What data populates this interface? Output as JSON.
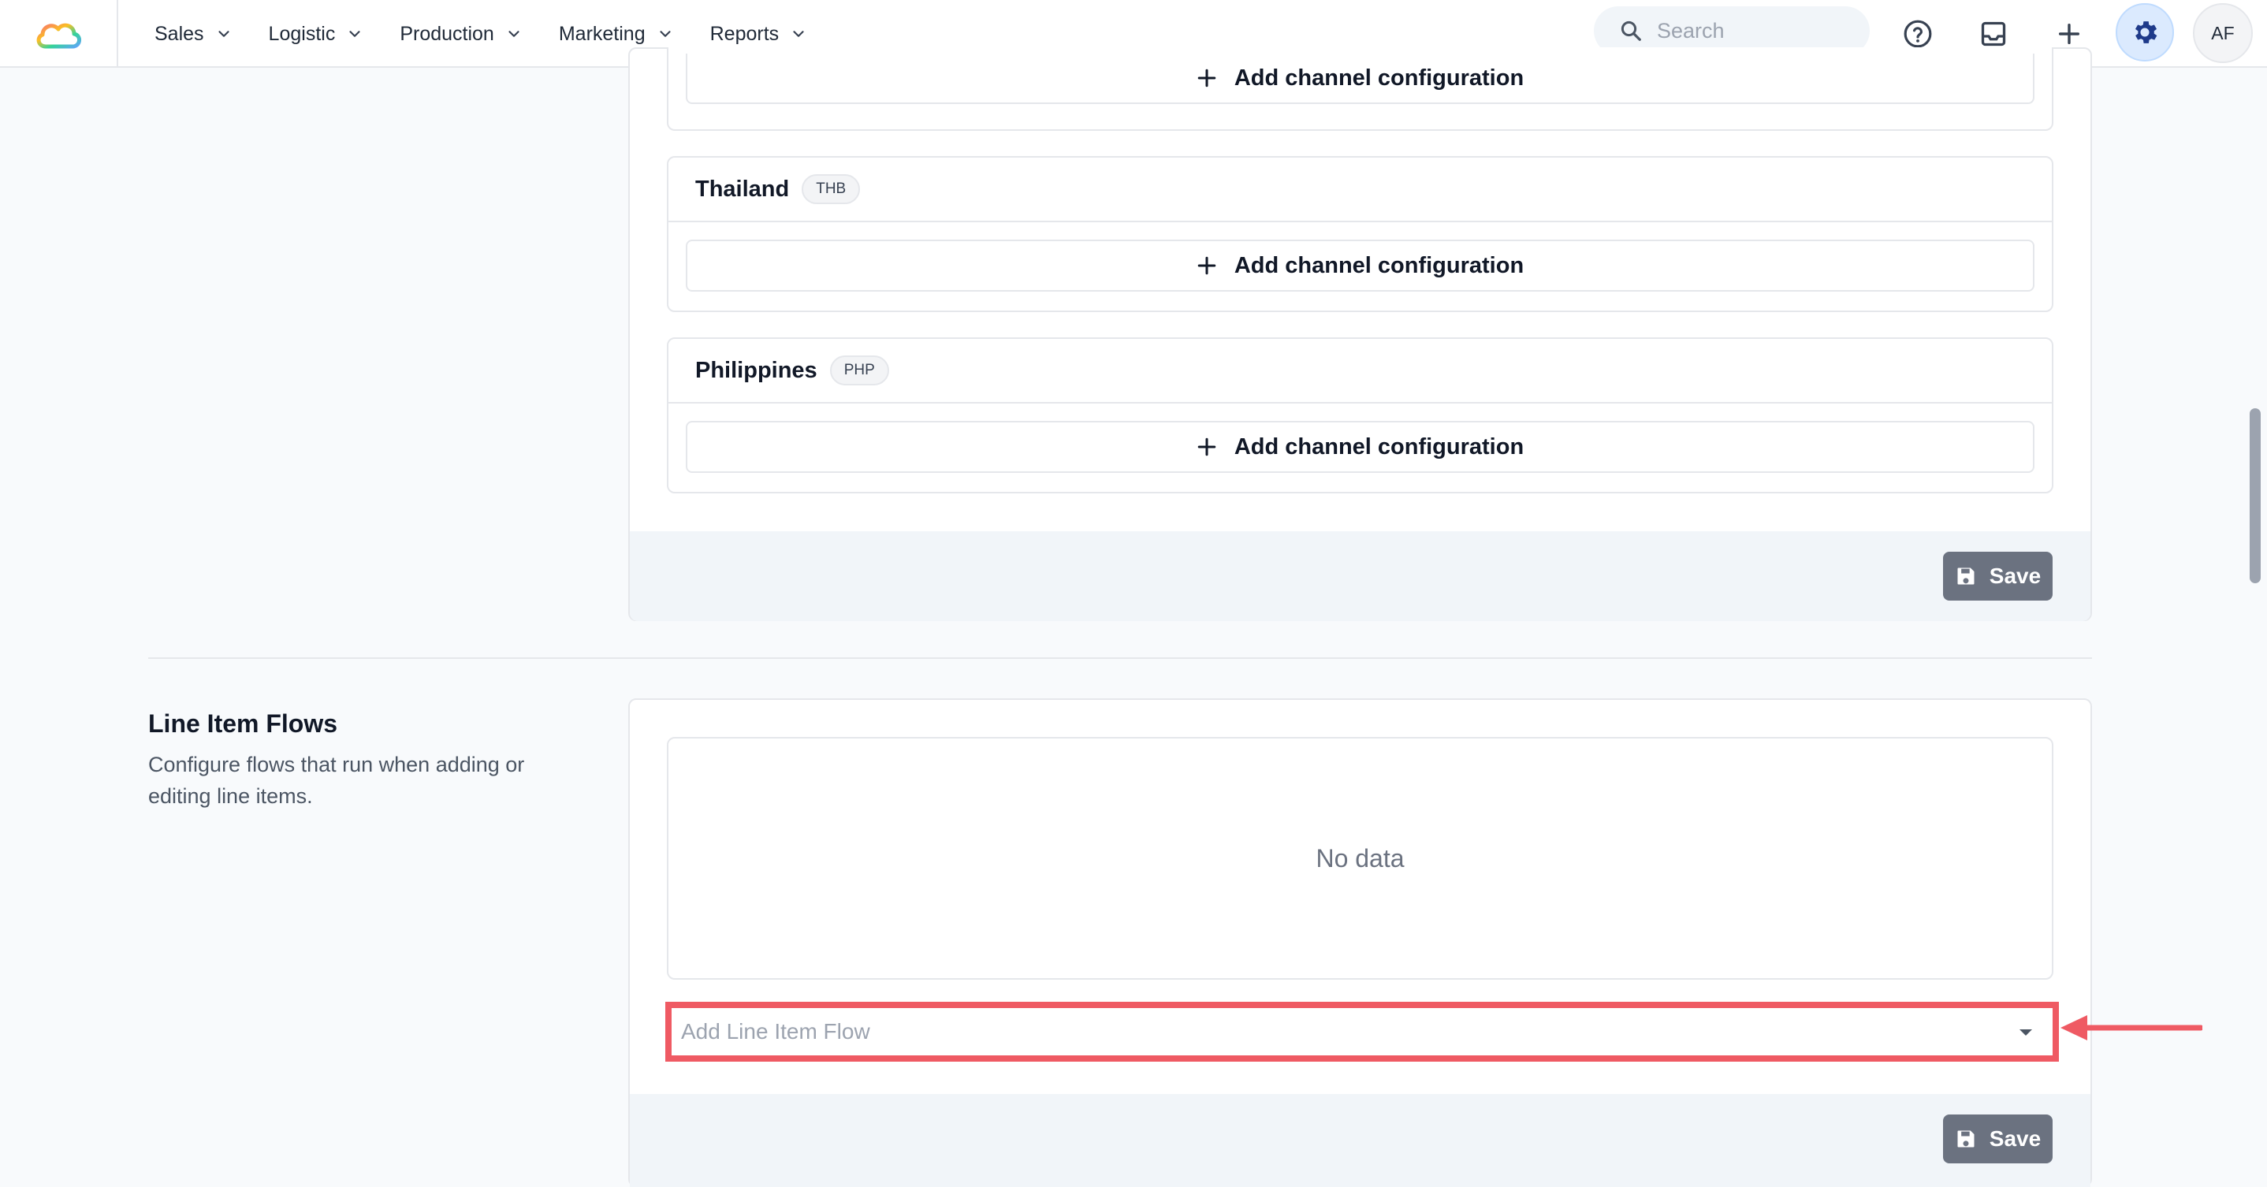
{
  "nav": {
    "items": [
      {
        "label": "Sales"
      },
      {
        "label": "Logistic"
      },
      {
        "label": "Production"
      },
      {
        "label": "Marketing"
      },
      {
        "label": "Reports"
      }
    ],
    "search_placeholder": "Search",
    "avatar_initials": "AF"
  },
  "countries": [
    {
      "name": "Thailand",
      "currency": "THB"
    },
    {
      "name": "Philippines",
      "currency": "PHP"
    }
  ],
  "add_channel_label": "Add channel configuration",
  "save_label": "Save",
  "line_item_flows": {
    "title": "Line Item Flows",
    "description": "Configure flows that run when adding or editing line items.",
    "empty_text": "No data",
    "select_placeholder": "Add Line Item Flow"
  },
  "colors": {
    "highlight": "#ef5a63",
    "accent": "#1e3a8a",
    "save_button": "#6b7280"
  },
  "icons": [
    "cloud-logo-icon",
    "chevron-down-icon",
    "search-icon",
    "help-icon",
    "inbox-icon",
    "plus-icon",
    "gear-icon",
    "save-icon",
    "caret-down-icon",
    "arrow-left-icon"
  ]
}
